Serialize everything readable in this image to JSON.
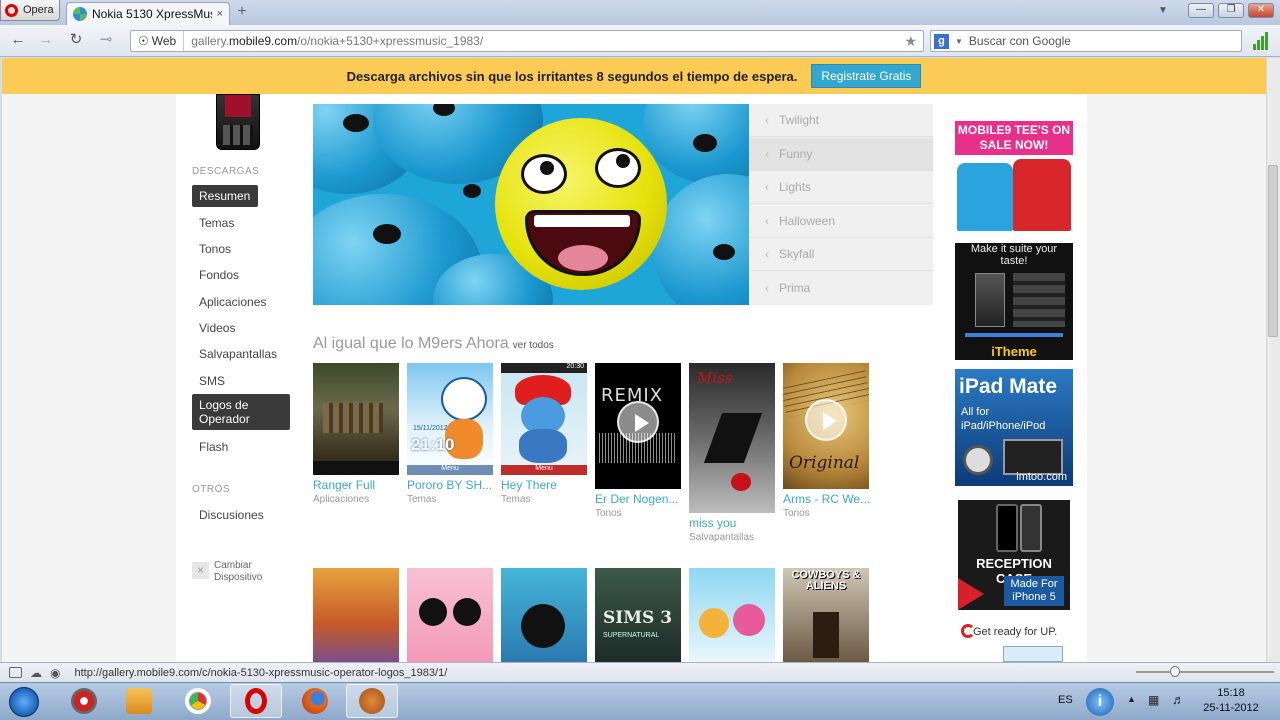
{
  "browser": {
    "menu_label": "Opera",
    "tab_title": "Nokia 5130 XpressMusi...",
    "tab_close": "×",
    "new_tab": "+",
    "window_buttons": [
      "—",
      "❐",
      "✕"
    ],
    "web_badge": "Web",
    "url_prefix": "gallery.",
    "url_domain": "mobile9.com",
    "url_path": "/o/nokia+5130+xpressmusic_1983/",
    "search_placeholder": "Buscar con Google",
    "status_url": "http://gallery.mobile9.com/c/nokia-5130-xpressmusic-operator-logos_1983/1/"
  },
  "promo": {
    "text": "Descarga archivos sin que los irritantes 8 segundos el tiempo de espera.",
    "button": "Registrate Gratis"
  },
  "sidebar": {
    "heading_downloads": "DESCARGAS",
    "items": [
      {
        "label": "Resumen",
        "active": true
      },
      {
        "label": "Temas"
      },
      {
        "label": "Tonos"
      },
      {
        "label": "Fondos"
      },
      {
        "label": "Aplicaciones"
      },
      {
        "label": "Videos"
      },
      {
        "label": "Salvapantallas"
      },
      {
        "label": "SMS"
      },
      {
        "label": "Logos de Operador",
        "active": true
      },
      {
        "label": "Flash"
      }
    ],
    "heading_others": "OTROS",
    "discussions": "Discusiones",
    "change_device": "Cambiar Dispositivo",
    "change_icon": "×"
  },
  "hero_menu": [
    "Twilight",
    "Funny",
    "Lights",
    "Halloween",
    "Skyfall",
    "Prima"
  ],
  "hero_chevron": "‹",
  "section": {
    "title": "Al igual que lo M9ers Ahora",
    "view_all": "ver todos"
  },
  "cards": [
    {
      "title": "Ranger Full",
      "category": "Aplicaciones"
    },
    {
      "title": "Pororo BY SH...",
      "category": "Temas"
    },
    {
      "title": "Hey There",
      "category": "Temas"
    },
    {
      "title": "Er Der Nogen...",
      "category": "Tonos"
    },
    {
      "title": "miss you",
      "category": "Salvapantallas"
    },
    {
      "title": "Arms - RC We...",
      "category": "Tonos"
    }
  ],
  "thumb_texts": {
    "remix": "REMIX",
    "original": "Original",
    "miss": "Miss",
    "pororo_time": "21:10",
    "pororo_date": "15/11/2012",
    "menu": "Menu",
    "hey_time": "20:30",
    "sims": "SIMS 3",
    "sims_sub": "SUPERNATURAL",
    "cowboys": "COWBOYS & ALIENS"
  },
  "ads": {
    "tees_title": "MOBILE9 TEE'S ON SALE NOW!",
    "itheme_top": "Make it suite your taste!",
    "itheme_name": "iTheme",
    "ipad_title": "iPad Mate",
    "ipad_sub": "All for iPad/iPhone/iPod",
    "ipad_site": "imtoo.com",
    "reception_title": "RECEPTION CASE",
    "reception_sub": "Made For iPhone 5",
    "up_text": "Get ready for UP."
  },
  "tray": {
    "lang": "ES",
    "time": "15:18",
    "date": "25-11-2012"
  },
  "colors": {
    "promo_bg": "#fbcb55",
    "accent_link": "#3aa7d4",
    "button_blue": "#34a7d0"
  }
}
